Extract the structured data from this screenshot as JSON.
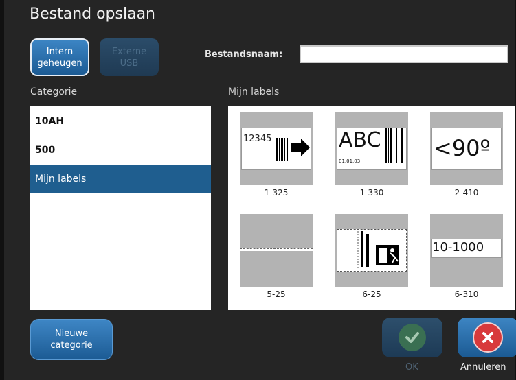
{
  "dialog": {
    "title": "Bestand opslaan"
  },
  "storage_tabs": {
    "internal": {
      "line1": "Intern",
      "line2": "geheugen"
    },
    "external": {
      "line1": "Externe",
      "line2": "USB"
    }
  },
  "filename": {
    "label": "Bestandsnaam:",
    "value": ""
  },
  "category_panel": {
    "heading": "Categorie",
    "items": [
      "10AH",
      "500",
      "Mijn labels"
    ],
    "selected": "Mijn labels"
  },
  "labels_panel": {
    "heading": "Mijn labels",
    "items": [
      {
        "caption": "1-325",
        "text": "12345"
      },
      {
        "caption": "1-330",
        "text": "ABC",
        "subtext": "01.01.03"
      },
      {
        "caption": "2-410",
        "text": "<90º"
      },
      {
        "caption": "5-25"
      },
      {
        "caption": "6-25"
      },
      {
        "caption": "6-310",
        "text": "10-1000"
      }
    ]
  },
  "buttons": {
    "new_category": {
      "line1": "Nieuwe",
      "line2": "categorie"
    },
    "ok": "OK",
    "cancel": "Annuleren"
  },
  "colors": {
    "accent": "#1f5e8f",
    "background": "#252525",
    "cancel_red": "#d8393b",
    "ok_green": "#3a6f52"
  }
}
